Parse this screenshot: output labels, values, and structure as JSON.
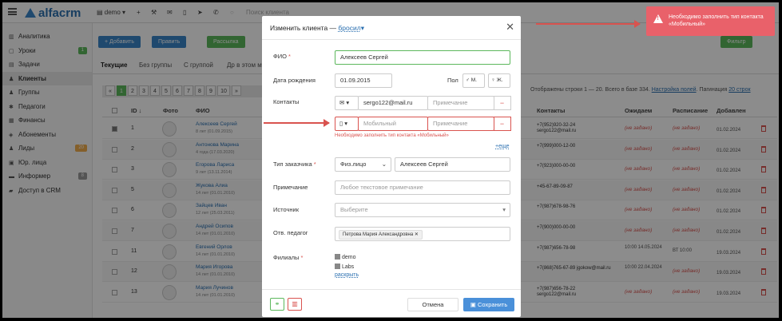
{
  "topbar": {
    "logo": "alfacrm",
    "branch": "demo",
    "search_placeholder": "Поиск клиента"
  },
  "sidebar": {
    "items": [
      {
        "label": "Аналитика",
        "icon": "chart-icon"
      },
      {
        "label": "Уроки",
        "icon": "calendar-icon",
        "badge": "1"
      },
      {
        "label": "Задачи",
        "icon": "tasks-icon"
      },
      {
        "label": "Клиенты",
        "icon": "user-icon",
        "active": true
      },
      {
        "label": "Группы",
        "icon": "users-icon"
      },
      {
        "label": "Педагоги",
        "icon": "teacher-icon"
      },
      {
        "label": "Финансы",
        "icon": "finance-icon"
      },
      {
        "label": "Абонементы",
        "icon": "subscription-icon"
      },
      {
        "label": "Лиды",
        "icon": "leads-icon",
        "badge": "20"
      },
      {
        "label": "Юр. лица",
        "icon": "company-icon"
      },
      {
        "label": "Информер",
        "icon": "informer-icon",
        "badge": "8"
      },
      {
        "label": "Доступ в CRM",
        "icon": "lock-icon"
      }
    ]
  },
  "toolbar": {
    "add": "+ Добавить",
    "edit": "Править",
    "mailing": "Рассылка",
    "filter": "Фильтр"
  },
  "tabs": [
    "Текущие",
    "Без группы",
    "С группой",
    "Др в этом м"
  ],
  "pager": {
    "pages": [
      "1",
      "2",
      "3",
      "4",
      "5",
      "6",
      "7",
      "8",
      "9",
      "10"
    ],
    "stats_text": "Отображены строки 1 — 20. Всего в базе 334.",
    "fields_link": "Настройка полей",
    "pagination_text": "Пагинация",
    "pagination_value": "20 строк"
  },
  "table": {
    "headers": [
      "ID",
      "Фото",
      "ФИО",
      "Контакты",
      "Ожидаем",
      "Расписание",
      "Добавлен"
    ],
    "rows": [
      {
        "id": "1",
        "name": "Алексеев Сергей",
        "sub": "8 лет (01.09.2015)",
        "contact": "+7(952)920-32-24 sergo122@mail.ru",
        "wait": "(не задано)",
        "sched": "(не задано)",
        "added": "01.02.2024",
        "checked": true
      },
      {
        "id": "2",
        "name": "Антонова Марина",
        "sub": "4 года (17.03.2020)",
        "contact": "+7(999)000-12-00",
        "wait": "(не задано)",
        "sched": "(не задано)",
        "added": "01.02.2024"
      },
      {
        "id": "3",
        "name": "Егорова Лариса",
        "sub": "9 лет (13.11.2014)",
        "contact": "+7(923)000-00-00",
        "wait": "(не задано)",
        "sched": "(не задано)",
        "added": "01.02.2024"
      },
      {
        "id": "5",
        "name": "Жукова Алиа",
        "sub": "14 лет (01.01.2010)",
        "contact": "+45-67-89-09-87",
        "wait": "(не задано)",
        "sched": "(не задано)",
        "added": "01.02.2024"
      },
      {
        "id": "6",
        "name": "Зайцев Иван",
        "sub": "12 лет (25.03.2011)",
        "contact": "+7(987)678-98-76",
        "wait": "(не задано)",
        "sched": "(не задано)",
        "added": "01.02.2024"
      },
      {
        "id": "7",
        "name": "Андрей Осипов",
        "sub": "14 лет (01.01.2010)",
        "contact": "+7(900)000-00-00",
        "wait": "(не задано)",
        "sched": "(не задано)",
        "added": "01.02.2024"
      },
      {
        "id": "11",
        "name": "Евгений Орлов",
        "sub": "14 лет (01.01.2010)",
        "contact": "+7(987)656-78-98",
        "wait": "10:00 14.05.2024",
        "sched": "ВТ 10:00",
        "added": "19.03.2024"
      },
      {
        "id": "12",
        "name": "Мария Игорова",
        "sub": "14 лет (01.01.2010)",
        "contact": "+7(868)765-67-89 jgokow@mail.ru",
        "wait": "10:00 22.04.2024",
        "sched": "(не задано)",
        "added": "19.03.2024"
      },
      {
        "id": "13",
        "name": "Мария Лучинов",
        "sub": "14 лет (01.01.2010)",
        "contact": "+7(987)656-78-22 sergo122@mail.ru",
        "wait": "(не задано)",
        "sched": "(не задано)",
        "added": "19.03.2024"
      }
    ]
  },
  "modal": {
    "title": "Изменить клиента",
    "dash": "—",
    "status": "бросил",
    "fio_label": "ФИО",
    "fio_value": "Алексеев Сергей",
    "birth_label": "Дата рождения",
    "birth_value": "01.09.2015",
    "gender_label": "Пол",
    "gender_m": "М.",
    "gender_f": "Ж.",
    "contacts_label": "Контакты",
    "email_value": "sergo122@mail.ru",
    "note_placeholder": "Примечание",
    "mobile_placeholder": "Мобильный",
    "error_text": "Необходимо заполнить тип контакта «Мобильный»",
    "more_link": "+еще",
    "customer_type_label": "Тип заказчика",
    "customer_type_value": "Физ.лицо",
    "customer_name_value": "Алексеев Сергей",
    "note_label": "Примечание",
    "note_area_placeholder": "Любое текстовое примечание",
    "source_label": "Источник",
    "source_placeholder": "Выберите",
    "teacher_label": "Отв. педагог",
    "teacher_value": "Петрова Мария Александровна",
    "branches_label": "Филиалы",
    "branch_1": "demo",
    "branch_2": "Labs",
    "expand_link": "раскрыть",
    "cancel": "Отмена",
    "save": "Сохранить"
  },
  "notification": {
    "text": "Необходимо заполнить тип контакта «Мобильный»"
  },
  "colors": {
    "accent": "#2a6fb0",
    "success": "#5cb85c",
    "danger": "#d9534f",
    "notify": "#e9616a",
    "save_button": "#4a90d9"
  }
}
